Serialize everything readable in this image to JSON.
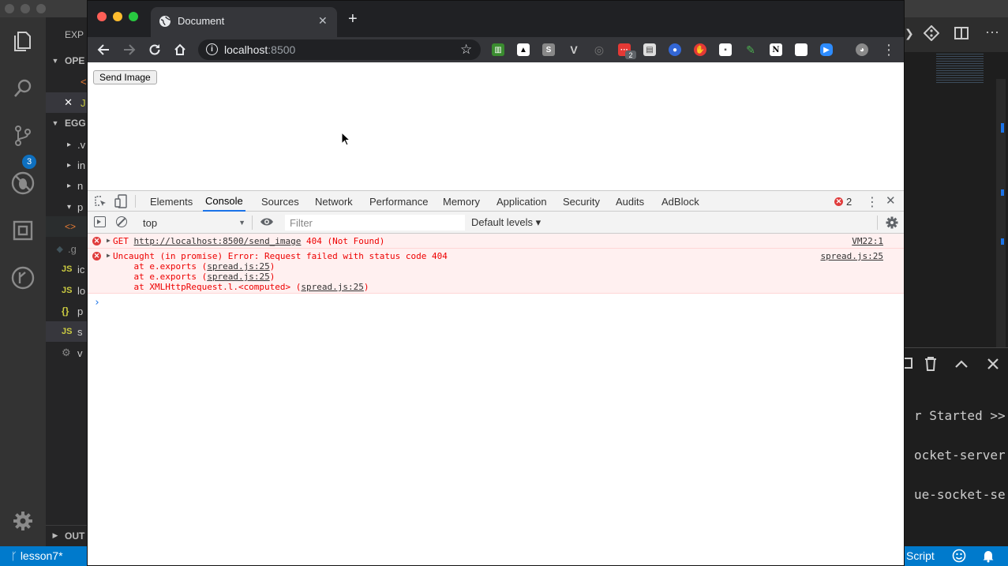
{
  "vscode": {
    "sidebar": {
      "explorer_header": "EXP",
      "open_editors_header": "OPE",
      "project_header": "EGG",
      "outline_header": "OUT",
      "rows": [
        {
          "icon": "",
          "text": "<"
        },
        {
          "icon": "✕",
          "text": "J"
        },
        {
          "icon": "▸",
          "text": ".v"
        },
        {
          "icon": "▸",
          "text": "in"
        },
        {
          "icon": "▸",
          "text": "n"
        },
        {
          "icon": "▾",
          "text": "p"
        },
        {
          "icon": "<>",
          "text": "<"
        },
        {
          "icon": "◆",
          "text": ".g"
        },
        {
          "icon": "JS",
          "text": "ic"
        },
        {
          "icon": "JS",
          "text": "lo"
        },
        {
          "icon": "{}",
          "text": "p"
        },
        {
          "icon": "JS",
          "text": "s"
        },
        {
          "icon": "⚙",
          "text": "v"
        }
      ]
    },
    "scm_badge": "3",
    "terminal_lines": [
      "r Started >>",
      "ocket-server",
      "ue-socket-se"
    ],
    "status_bar": {
      "branch": "lesson7*",
      "language": "Script"
    }
  },
  "browser": {
    "tab_title": "Document",
    "url_host": "localhost",
    "url_port": ":8500",
    "ext_badge": "2"
  },
  "page": {
    "send_button": "Send Image"
  },
  "devtools": {
    "tabs": [
      "Elements",
      "Console",
      "Sources",
      "Network",
      "Performance",
      "Memory",
      "Application",
      "Security",
      "Audits",
      "AdBlock"
    ],
    "active_tab": "Console",
    "error_count": "2",
    "context": "top",
    "filter_placeholder": "Filter",
    "levels": "Default levels ▾",
    "messages": [
      {
        "method": "GET",
        "url": "http://localhost:8500/send_image",
        "status": "404 (Not Found)",
        "source": "VM22:1"
      },
      {
        "text": "Uncaught (in promise) Error: Request failed with status code 404",
        "source": "spread.js:25",
        "stack": [
          {
            "prefix": "    at e.exports (",
            "link": "spread.js:25",
            "suffix": ")"
          },
          {
            "prefix": "    at e.exports (",
            "link": "spread.js:25",
            "suffix": ")"
          },
          {
            "prefix": "    at XMLHttpRequest.l.<computed> (",
            "link": "spread.js:25",
            "suffix": ")"
          }
        ]
      }
    ]
  },
  "colors": {
    "vscode_status": "#007acc",
    "chrome_frame": "#202124",
    "error_red": "#e00000",
    "error_bg": "#fff0f0",
    "active_tab_underline": "#1a73e8"
  }
}
